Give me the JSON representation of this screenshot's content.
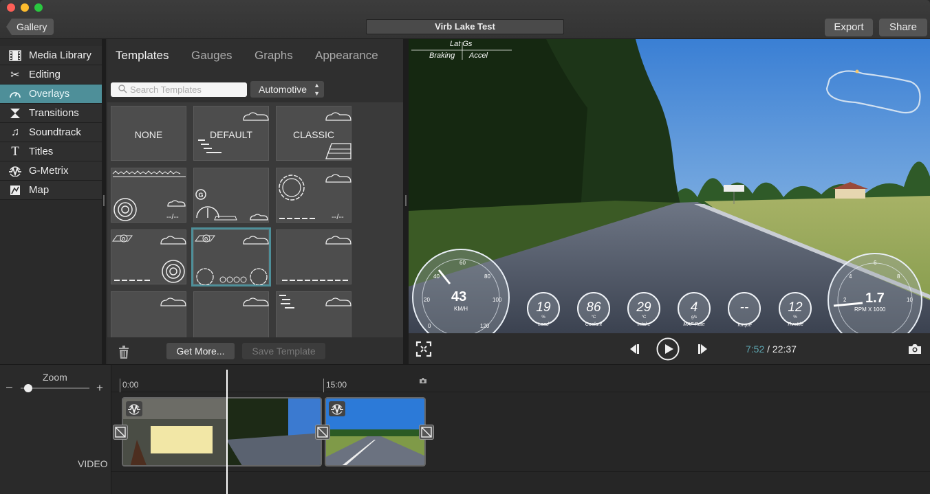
{
  "window": {
    "title": "Virb Lake Test",
    "back_label": "Gallery",
    "export_label": "Export",
    "share_label": "Share"
  },
  "sidebar": {
    "items": [
      {
        "label": "Media Library",
        "icon": "film-icon"
      },
      {
        "label": "Editing",
        "icon": "scissors-icon"
      },
      {
        "label": "Overlays",
        "icon": "gauge-icon",
        "active": true
      },
      {
        "label": "Transitions",
        "icon": "transition-icon"
      },
      {
        "label": "Soundtrack",
        "icon": "music-note-icon"
      },
      {
        "label": "Titles",
        "icon": "text-t-icon"
      },
      {
        "label": "G-Metrix",
        "icon": "gmetrix-icon"
      },
      {
        "label": "Map",
        "icon": "map-icon"
      }
    ]
  },
  "templates_panel": {
    "tabs": [
      "Templates",
      "Gauges",
      "Graphs",
      "Appearance"
    ],
    "active_tab": "Templates",
    "search_placeholder": "Search Templates",
    "category_select": "Automotive",
    "tiles": [
      {
        "label": "NONE"
      },
      {
        "label": "DEFAULT"
      },
      {
        "label": "CLASSIC"
      }
    ],
    "get_more_label": "Get More...",
    "save_template_label": "Save Template"
  },
  "preview": {
    "hud": {
      "latg_label": "Lat Gs",
      "braking_label": "Braking",
      "accel_label": "Accel",
      "speed_value": "43",
      "speed_unit": "KM/H",
      "rpm_value": "1.7",
      "rpm_unit": "RPM X 1000",
      "gauges": [
        {
          "value": "19",
          "unit": "%",
          "name": "Load"
        },
        {
          "value": "86",
          "unit": "°C",
          "name": "Coolant"
        },
        {
          "value": "29",
          "unit": "°C",
          "name": "Intake"
        },
        {
          "value": "4",
          "unit": "g/s",
          "name": "MAF Rate"
        },
        {
          "value": "--",
          "unit": "",
          "name": "Torque"
        },
        {
          "value": "12",
          "unit": "%",
          "name": "Throttle"
        }
      ]
    }
  },
  "controls": {
    "current_time": "7:52",
    "separator": "/",
    "total_time": "22:37"
  },
  "timeline": {
    "zoom_label": "Zoom",
    "zoom_minus": "–",
    "zoom_plus": "+",
    "zoom_level": 0.15,
    "marks": [
      "0:00",
      "15:00"
    ],
    "track_label": "VIDEO"
  }
}
